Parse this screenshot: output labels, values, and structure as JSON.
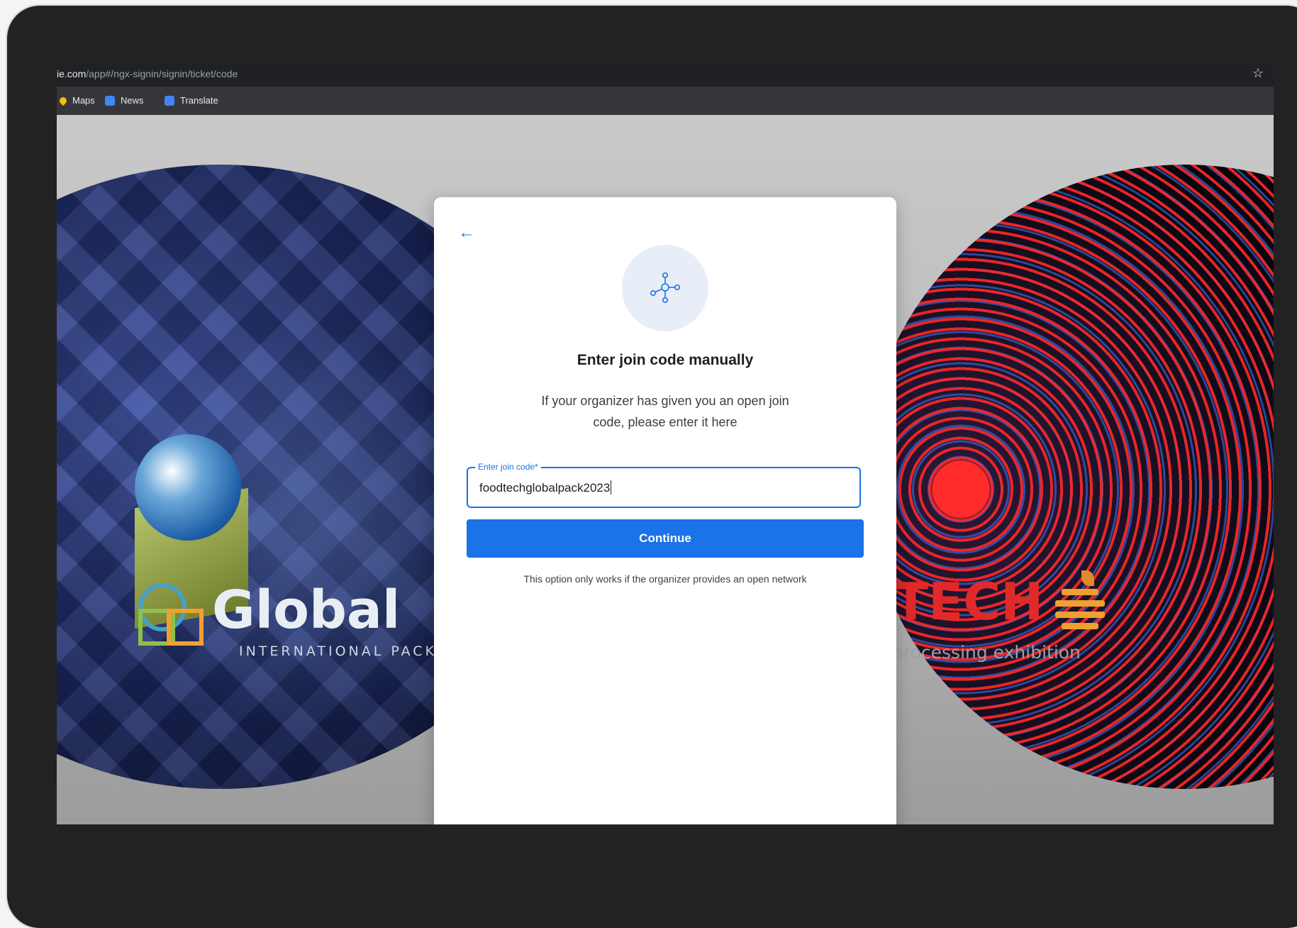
{
  "browser": {
    "url_host": "ie.com",
    "url_path": "/app#/ngx-signin/signin/ticket/code",
    "bookmarks": [
      {
        "label": "Maps",
        "icon": "maps-pin-icon",
        "color": "#fbbc04"
      },
      {
        "label": "News",
        "icon": "news-icon",
        "color": "#4285f4"
      },
      {
        "label": "Translate",
        "icon": "translate-icon",
        "color": "#4285f4"
      }
    ]
  },
  "background": {
    "left_logo_text": "Global",
    "left_logo_subtext": "INTERNATIONAL PACKA",
    "right_logo_text": "TECH",
    "right_logo_subtext": "processing exhibition"
  },
  "modal": {
    "title": "Enter join code manually",
    "description": "If your organizer has given you an open join code, please enter it here",
    "field_label": "Enter join code*",
    "field_value": "foodtechglobalpack2023",
    "continue_label": "Continue",
    "note": "This option only works if the organizer provides an open network",
    "accent": "#1a73e8"
  }
}
